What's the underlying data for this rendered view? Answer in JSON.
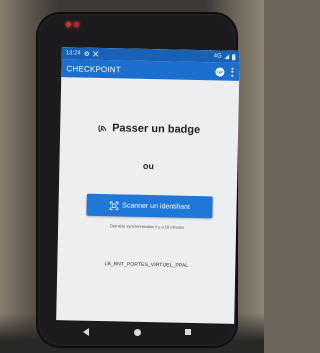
{
  "status_bar": {
    "time": "13:24",
    "left_icons": [
      "gear-icon",
      "tools-icon"
    ],
    "right_text": "4G",
    "right_icons": [
      "signal-icon",
      "battery-icon"
    ]
  },
  "app_bar": {
    "title": "CHECKPOINT",
    "avatar_initials": "GP",
    "overflow_icon": "more-vert-icon"
  },
  "main": {
    "badge_icon": "nfc-icon",
    "badge_title": "Passer un badge",
    "separator": "ou",
    "scan_button_icon": "qr-scan-icon",
    "scan_button_label": "Scanner un identifiant",
    "last_sync": "Dernière synchronisation il y a 18 minutes",
    "checkpoint_id": "LB_BNT_PORTES_VIRTUEL_PPAL"
  },
  "nav_bar": {
    "icons": [
      "back-icon",
      "home-icon",
      "recents-icon"
    ]
  },
  "colors": {
    "app_bar": "#1c6fcf",
    "status_bar": "#1762b6",
    "button": "#1f78d8",
    "screen_bg": "#edeeef",
    "device": "#1b1b1d"
  }
}
